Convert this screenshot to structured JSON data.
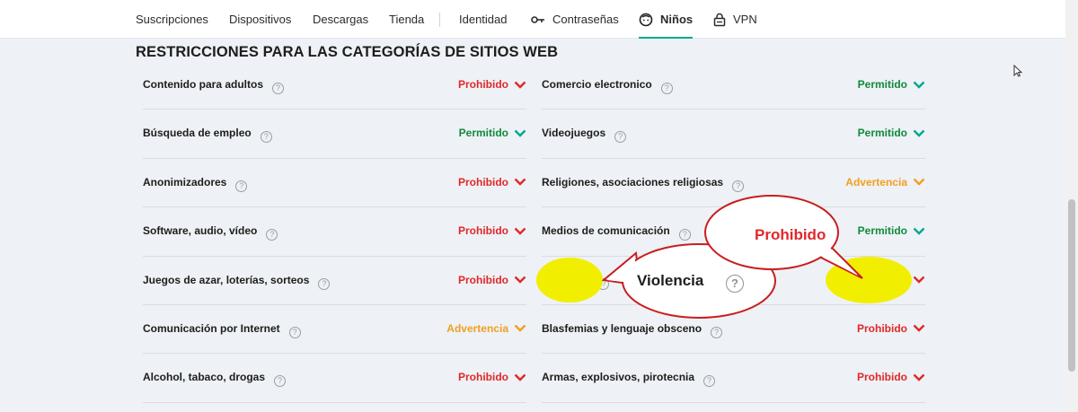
{
  "nav": {
    "items": [
      {
        "label": "Suscripciones",
        "icon": ""
      },
      {
        "label": "Dispositivos",
        "icon": ""
      },
      {
        "label": "Descargas",
        "icon": ""
      },
      {
        "label": "Tienda",
        "icon": ""
      },
      {
        "label": "Identidad",
        "icon": ""
      },
      {
        "label": "Contraseñas",
        "icon": "key-icon"
      },
      {
        "label": "Niños",
        "icon": "kid-face-icon",
        "active": true
      },
      {
        "label": "VPN",
        "icon": "vpn-lock-icon"
      }
    ]
  },
  "section": {
    "title": "RESTRICCIONES PARA LAS CATEGORÍAS DE SITIOS WEB"
  },
  "categories": {
    "left": [
      {
        "name": "Contenido para adultos",
        "status": "Prohibido"
      },
      {
        "name": "Búsqueda de empleo",
        "status": "Permitido"
      },
      {
        "name": "Anonimizadores",
        "status": "Prohibido"
      },
      {
        "name": "Software, audio, vídeo",
        "status": "Prohibido"
      },
      {
        "name": "Juegos de azar, loterías, sorteos",
        "status": "Prohibido"
      },
      {
        "name": "Comunicación por Internet",
        "status": "Advertencia"
      },
      {
        "name": "Alcohol, tabaco, drogas",
        "status": "Prohibido"
      }
    ],
    "right": [
      {
        "name": "Comercio electronico",
        "status": "Permitido"
      },
      {
        "name": "Videojuegos",
        "status": "Permitido"
      },
      {
        "name": "Religiones, asociaciones religiosas",
        "status": "Advertencia"
      },
      {
        "name": "Medios de comunicación",
        "status": "Permitido"
      },
      {
        "name": "Violencia",
        "status": "Prohibido"
      },
      {
        "name": "Blasfemias y lenguaje obsceno",
        "status": "Prohibido"
      },
      {
        "name": "Armas, explosivos, pirotecnia",
        "status": "Prohibido"
      }
    ]
  },
  "annotations": {
    "prohibido_callout": "Prohibido",
    "violencia_callout": "Violencia",
    "help_glyph": "?"
  },
  "colors": {
    "prohibido": "#e0282b",
    "permitido": "#0f8a3c",
    "advertencia": "#f0a020",
    "chevron_permitido": "#00a88e",
    "accent": "#00a88e",
    "highlight": "#f2ee00"
  }
}
